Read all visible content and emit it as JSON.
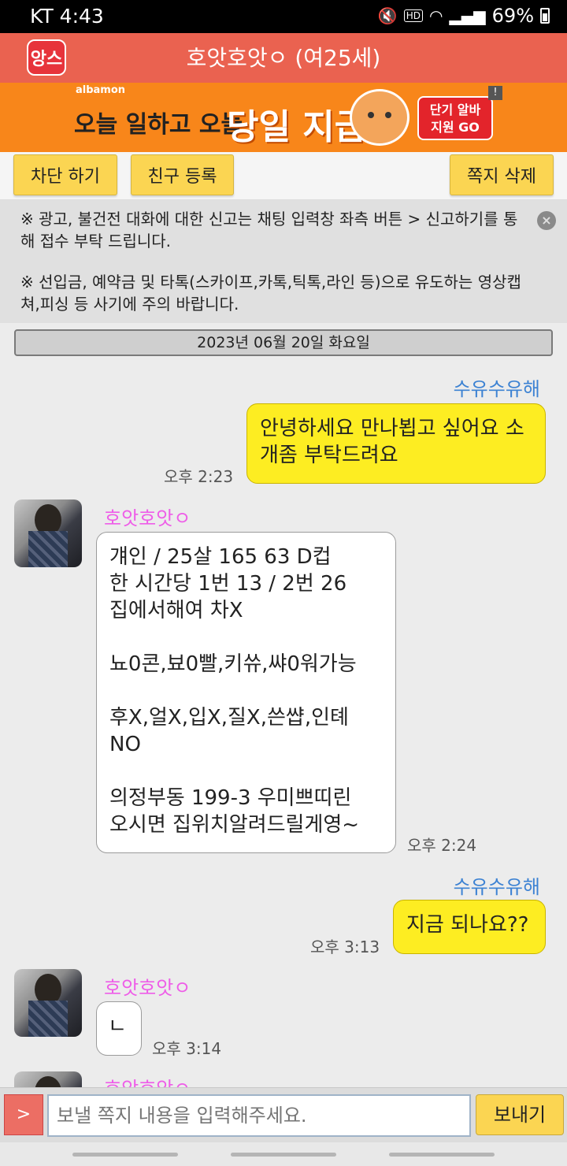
{
  "status_bar": {
    "carrier_time": "KT 4:43",
    "battery": "69%"
  },
  "header": {
    "logo_text": "앙스",
    "title": "호앗호앗ㅇ (여25세)"
  },
  "ad": {
    "brand": "albamon",
    "text1": "오늘 일하고 오늘",
    "text2": "당일 지급",
    "cta": "단기 알바\n지원 GO",
    "mark": "!"
  },
  "actions": {
    "block": "차단 하기",
    "add_friend": "친구 등록",
    "delete": "쪽지 삭제"
  },
  "notice": {
    "line1": "※ 광고, 불건전 대화에 대한 신고는 채팅 입력창 좌측 버튼 > 신고하기를 통해 접수 부탁 드립니다.",
    "line2": "※ 선입금, 예약금 및 타톡(스카이프,카톡,틱톡,라인 등)으로 유도하는 영상캡쳐,피싱 등 사기에 주의 바랍니다.",
    "close": "×"
  },
  "date": "2023년 06월 20일 화요일",
  "messages": [
    {
      "sender": "수유수유해",
      "text": "안녕하세요 만나뵙고 싶어요 소개좀 부탁드려요",
      "time": "오후 2:23"
    },
    {
      "sender": "호앗호앗ㅇ",
      "text": "걔인 / 25살 165 63 D컵\n한 시간당 1번 13 / 2번 26\n집에서해여 차X\n\n뇨0콘,뵤0빨,키쓔,쌰0워가능\n\n후X,얼X,입X,질X,쓴썁,인톄\nNO\n\n의정부동 199-3 우미쁘띠린\n오시면 집위치알려드릴게영~",
      "time": "오후 2:24"
    },
    {
      "sender": "수유수유해",
      "text": "지금 되나요??",
      "time": "오후 3:13"
    },
    {
      "sender": "호앗호앗ㅇ",
      "text": "ㄴ",
      "time": "오후 3:14"
    },
    {
      "sender": "호앗호앗ㅇ"
    }
  ],
  "input": {
    "report_label": ">",
    "placeholder": "보낼 쪽지 내용을 입력해주세요.",
    "send": "보내기"
  }
}
